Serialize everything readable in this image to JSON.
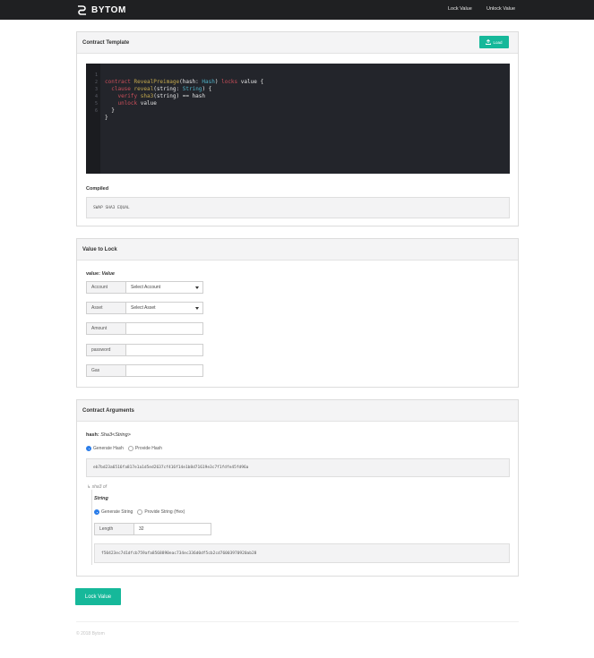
{
  "nav": {
    "brand": "BYTOM",
    "links": [
      "Lock Value",
      "Unlock Value"
    ]
  },
  "template_panel": {
    "title": "Contract Template",
    "load_button": "Load",
    "code_lines": [
      {
        "n": "1"
      },
      {
        "n": "2"
      },
      {
        "n": "3"
      },
      {
        "n": "4"
      },
      {
        "n": "5"
      },
      {
        "n": "6"
      }
    ],
    "compiled_label": "Compiled",
    "compiled_value": "SWAP SHA3 EQUAL"
  },
  "lock_panel": {
    "title": "Value to Lock",
    "value_label": "value:",
    "value_type": "Value",
    "fields": [
      {
        "label": "Account",
        "value": "Select Account",
        "dropdown": true
      },
      {
        "label": "Asset",
        "value": "Select Asset",
        "dropdown": true
      },
      {
        "label": "Amount",
        "value": "",
        "dropdown": false
      },
      {
        "label": "password",
        "value": "",
        "dropdown": false
      },
      {
        "label": "Gas",
        "value": "",
        "dropdown": false
      }
    ]
  },
  "args_panel": {
    "title": "Contract Arguments",
    "hash_label": "hash:",
    "hash_type": "Sha3<String>",
    "hash_options": [
      "Generate Hash",
      "Provide Hash"
    ],
    "hash_value": "eb7bd23a6516fa817e1a1d5ed2637cf416f14e1b8d71619e3c7f1fdfe45fd96a",
    "sha3_of_label": "sha3 of",
    "string_label": "String",
    "string_options": [
      "Generate String",
      "Provide String (Hex)"
    ],
    "length_label": "Length",
    "length_value": "32",
    "string_value": "f50423ec7d1dfcb759afa8568890eac734ec336d0df5cb2cd76003970920ab28"
  },
  "lock_button": "Lock Value",
  "footer": "© 2018 Bytom",
  "colors": {
    "accent": "#16b89a",
    "navbar": "#1f2022",
    "radio_selected": "#2b7de9",
    "editor_bg": "#23252b"
  }
}
